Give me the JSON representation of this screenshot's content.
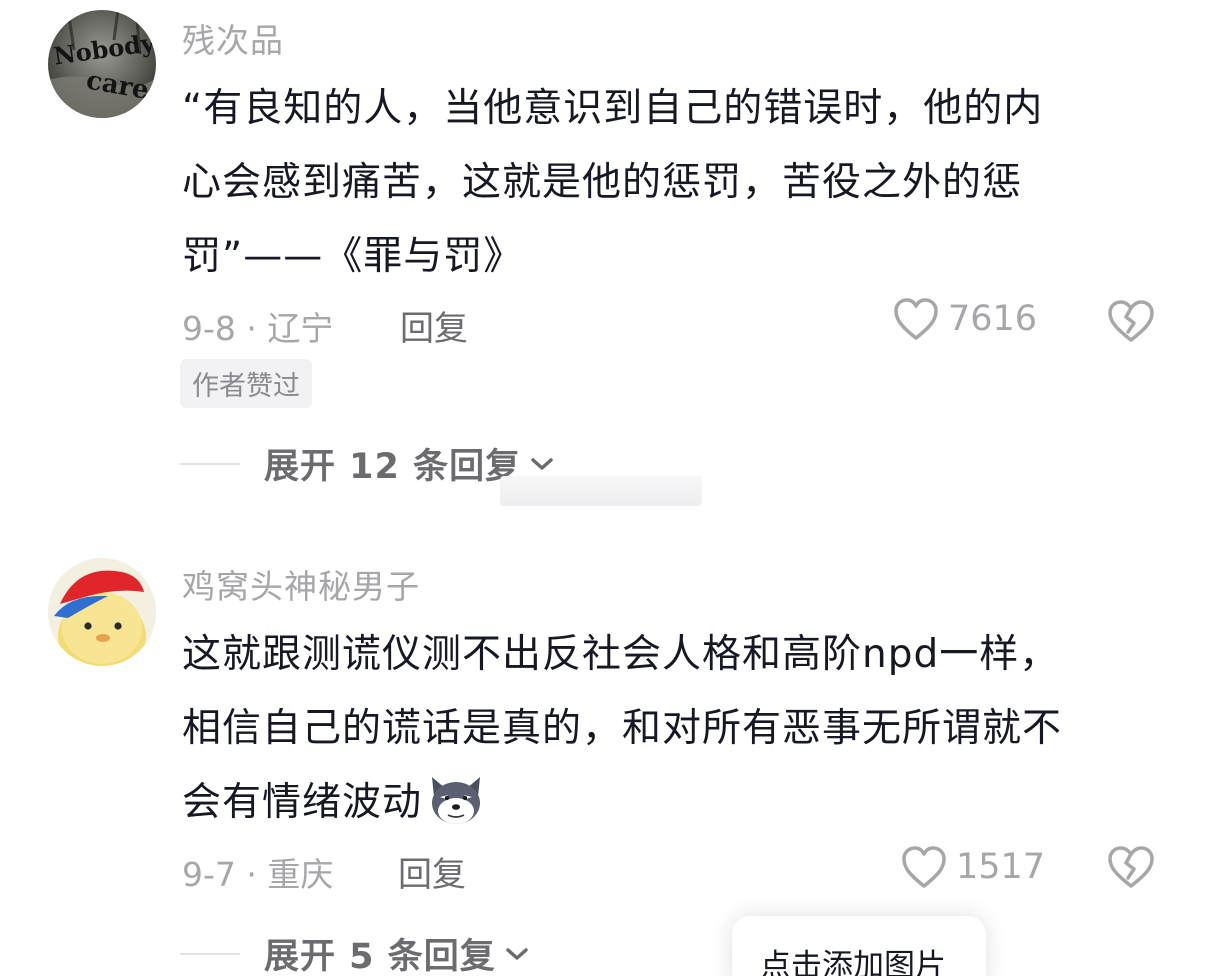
{
  "comments": [
    {
      "avatar_text_1": "Nobody",
      "avatar_text_2": "cares",
      "username": "残次品",
      "text_lines": [
        "“有良知的人，当他意识到自己的错误时，他的内",
        "心会感到痛苦，这就是他的惩罚，苦役之外的惩",
        "罚”——《罪与罚》"
      ],
      "date_location": "9-8 · 辽宁",
      "reply_label": "回复",
      "like_count": "7616",
      "author_badge": "作者赞过",
      "expand_label": "展开 12 条回复"
    },
    {
      "username": "鸡窝头神秘男子",
      "text_lines": [
        "这就跟测谎仪测不出反社会人格和高阶npd一样，",
        "相信自己的谎话是真的，和对所有恶事无所谓就不",
        "会有情绪波动"
      ],
      "emoji": "dog-face-emoji",
      "date_location": "9-7 · 重庆",
      "reply_label": "回复",
      "like_count": "1517",
      "expand_label": "展开 5 条回复"
    }
  ],
  "add_image_label": "点击添加图片",
  "icons": {
    "like": "heart-outline-icon",
    "dislike": "broken-heart-icon",
    "expand": "chevron-down-icon"
  },
  "colors": {
    "primary_text": "#161823",
    "secondary_text": "#a6a6ab",
    "link_text": "#6b6b70"
  }
}
